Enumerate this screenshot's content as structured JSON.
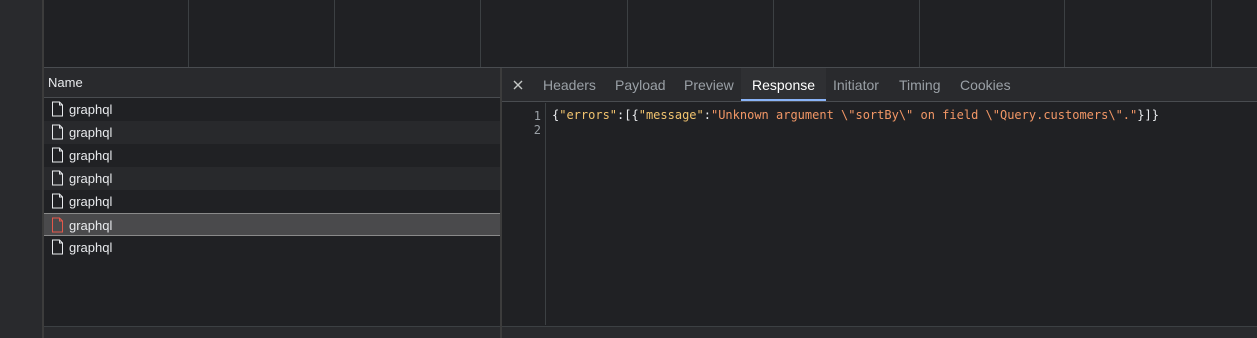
{
  "name_column": {
    "header": "Name",
    "rows": [
      {
        "label": "graphql",
        "state": "normal"
      },
      {
        "label": "graphql",
        "state": "normal"
      },
      {
        "label": "graphql",
        "state": "normal"
      },
      {
        "label": "graphql",
        "state": "normal"
      },
      {
        "label": "graphql",
        "state": "normal"
      },
      {
        "label": "graphql",
        "state": "error-selected"
      },
      {
        "label": "graphql",
        "state": "normal"
      }
    ]
  },
  "detail": {
    "tabs": [
      {
        "label": "Headers"
      },
      {
        "label": "Payload"
      },
      {
        "label": "Preview"
      },
      {
        "label": "Response",
        "active": true
      },
      {
        "label": "Initiator"
      },
      {
        "label": "Timing"
      },
      {
        "label": "Cookies"
      }
    ],
    "response": {
      "line_numbers": [
        "1",
        "2"
      ],
      "tokens": [
        {
          "t": "{",
          "k": "brace"
        },
        {
          "t": "\"errors\"",
          "k": "key"
        },
        {
          "t": ":[{",
          "k": "brace"
        },
        {
          "t": "\"message\"",
          "k": "key"
        },
        {
          "t": ":",
          "k": "brace"
        },
        {
          "t": "\"Unknown argument \\\"sortBy\\\" on field \\\"Query.customers\\\".\"",
          "k": "str"
        },
        {
          "t": "}]}",
          "k": "brace"
        }
      ]
    }
  },
  "colors": {
    "accent": "#8ab4f8",
    "error_icon": "#e4584b",
    "json_key": "#f2c46f",
    "json_string": "#f29766"
  }
}
